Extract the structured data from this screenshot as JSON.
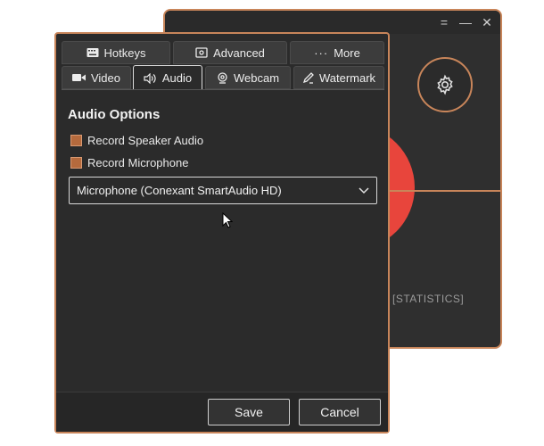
{
  "statistics_label": "[STATISTICS]",
  "window_controls": {
    "minimize": "=",
    "maximize": "—",
    "close": "✕"
  },
  "tabs_top": [
    {
      "label": "Hotkeys",
      "icon": "keyboard-icon"
    },
    {
      "label": "Advanced",
      "icon": "advanced-settings-icon"
    },
    {
      "label": "More",
      "icon": "more-icon"
    }
  ],
  "tabs_bottom": [
    {
      "label": "Video",
      "icon": "video-camera-icon"
    },
    {
      "label": "Audio",
      "icon": "speaker-icon",
      "selected": true
    },
    {
      "label": "Webcam",
      "icon": "webcam-icon"
    },
    {
      "label": "Watermark",
      "icon": "watermark-icon"
    }
  ],
  "audio": {
    "title": "Audio Options",
    "record_speaker_label": "Record Speaker Audio",
    "record_microphone_label": "Record Microphone",
    "microphone_selected": "Microphone (Conexant SmartAudio HD)"
  },
  "footer": {
    "save_label": "Save",
    "cancel_label": "Cancel"
  },
  "colors": {
    "accent": "#c8855a",
    "record": "#e8453c",
    "background": "#2b2b2b"
  }
}
